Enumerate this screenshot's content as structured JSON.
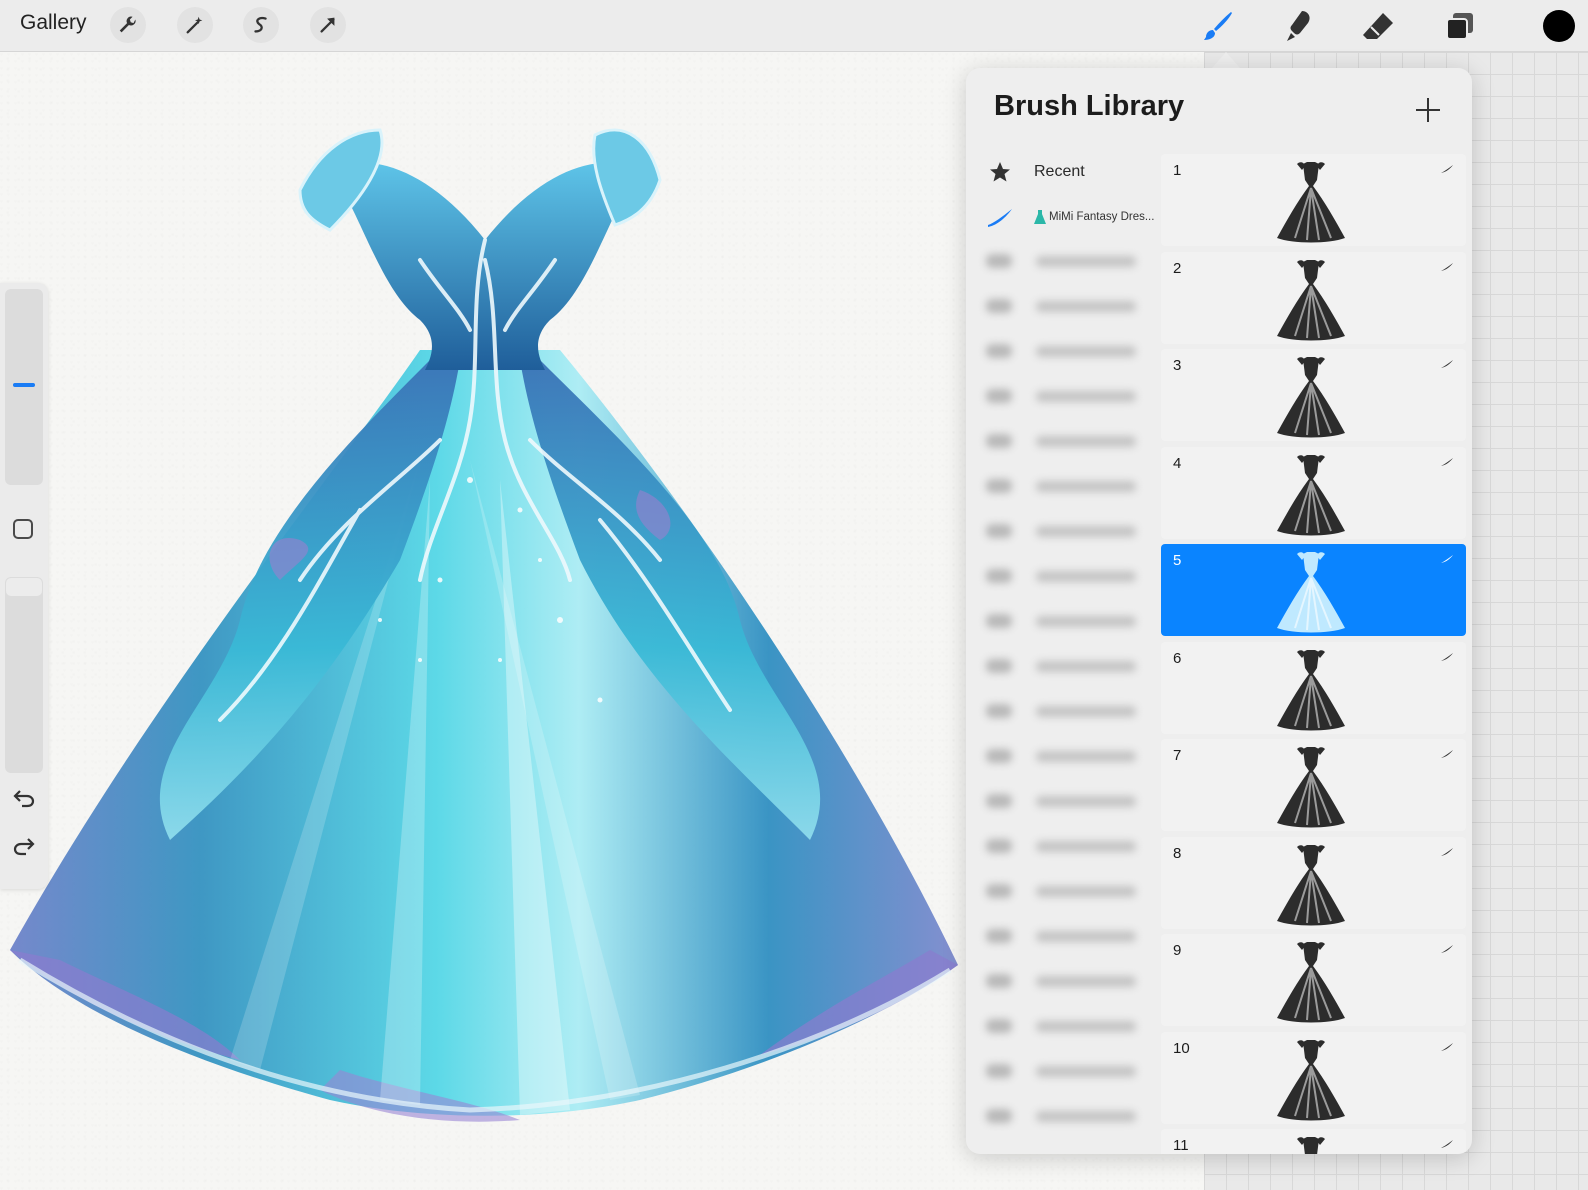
{
  "topbar": {
    "gallery_label": "Gallery",
    "tools_left": [
      "wrench-icon",
      "magic-wand-icon",
      "selection-s-icon",
      "transform-arrow-icon"
    ],
    "tools_right": [
      "brush-icon",
      "smudge-icon",
      "eraser-icon",
      "layers-icon"
    ],
    "active_tool": "brush-icon",
    "accent_color": "#1a7cf5",
    "current_color": "#000000"
  },
  "sidebar": {
    "brush_size_level": 0.47,
    "opacity_level": 1.0,
    "buttons": [
      "modify-square-icon",
      "undo-icon",
      "redo-icon"
    ]
  },
  "brush_library": {
    "title": "Brush Library",
    "add_icon": "plus-icon",
    "sets": [
      {
        "label": "Recent",
        "icon": "star-icon"
      },
      {
        "label": "MiMi Fantasy Dres...",
        "icon": "brush-stroke-icon",
        "prefix_icon": "dress-emoji-icon"
      }
    ],
    "blurred_set_count": 20,
    "brushes": [
      {
        "number": "1",
        "selected": false
      },
      {
        "number": "2",
        "selected": false
      },
      {
        "number": "3",
        "selected": false
      },
      {
        "number": "4",
        "selected": false
      },
      {
        "number": "5",
        "selected": true
      },
      {
        "number": "6",
        "selected": false
      },
      {
        "number": "7",
        "selected": false
      },
      {
        "number": "8",
        "selected": false
      },
      {
        "number": "9",
        "selected": false
      },
      {
        "number": "10",
        "selected": false
      },
      {
        "number": "11",
        "selected": false
      }
    ],
    "selected_color": "#0a84ff"
  }
}
